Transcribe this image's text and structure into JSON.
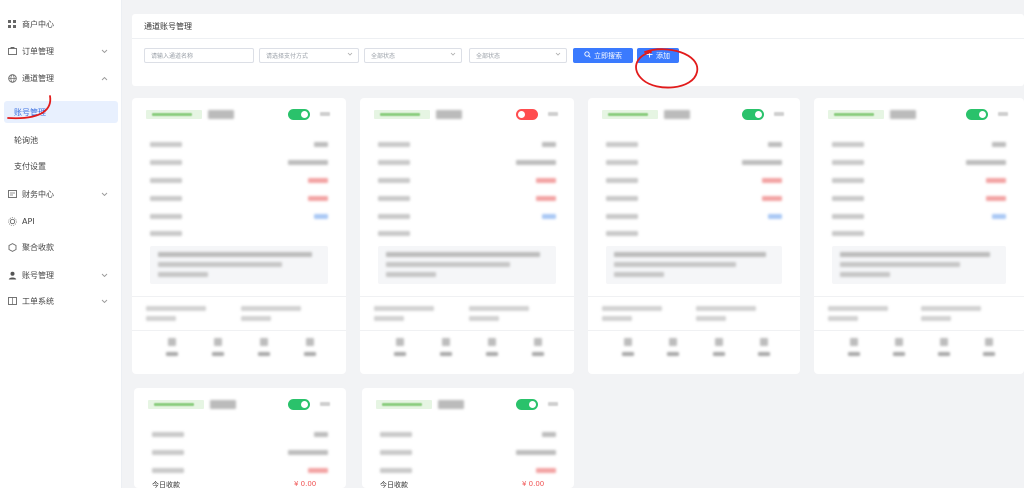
{
  "sidebar": {
    "items": [
      {
        "label": "商户中心",
        "icon": "grid-icon"
      },
      {
        "label": "订单管理",
        "icon": "folder-icon"
      },
      {
        "label": "通道管理",
        "icon": "globe-icon"
      },
      {
        "label": "账号管理",
        "icon": ""
      },
      {
        "label": "轮询池",
        "icon": ""
      },
      {
        "label": "支付设置",
        "icon": ""
      },
      {
        "label": "财务中心",
        "icon": "finance-icon"
      },
      {
        "label": "API",
        "icon": "api-icon"
      },
      {
        "label": "聚合收款",
        "icon": "aggregate-icon"
      },
      {
        "label": "账号管理",
        "icon": "user-icon"
      },
      {
        "label": "工单系统",
        "icon": "book-icon"
      }
    ]
  },
  "panel": {
    "title": "通道账号管理",
    "search_placeholder": "请输入通道名称",
    "pay_method": "请选择支付方式",
    "status1": "全部状态",
    "status2": "全部状态",
    "search_btn": "立即搜索",
    "add_btn": "添加"
  },
  "cards": {
    "today_label": "今日收款",
    "today_value": "¥ 0.00"
  },
  "colors": {
    "accent": "#3a7afe",
    "switch_on": "#2ac26b",
    "switch_off": "#ff4d4f",
    "annotation": "#e21b1b"
  }
}
